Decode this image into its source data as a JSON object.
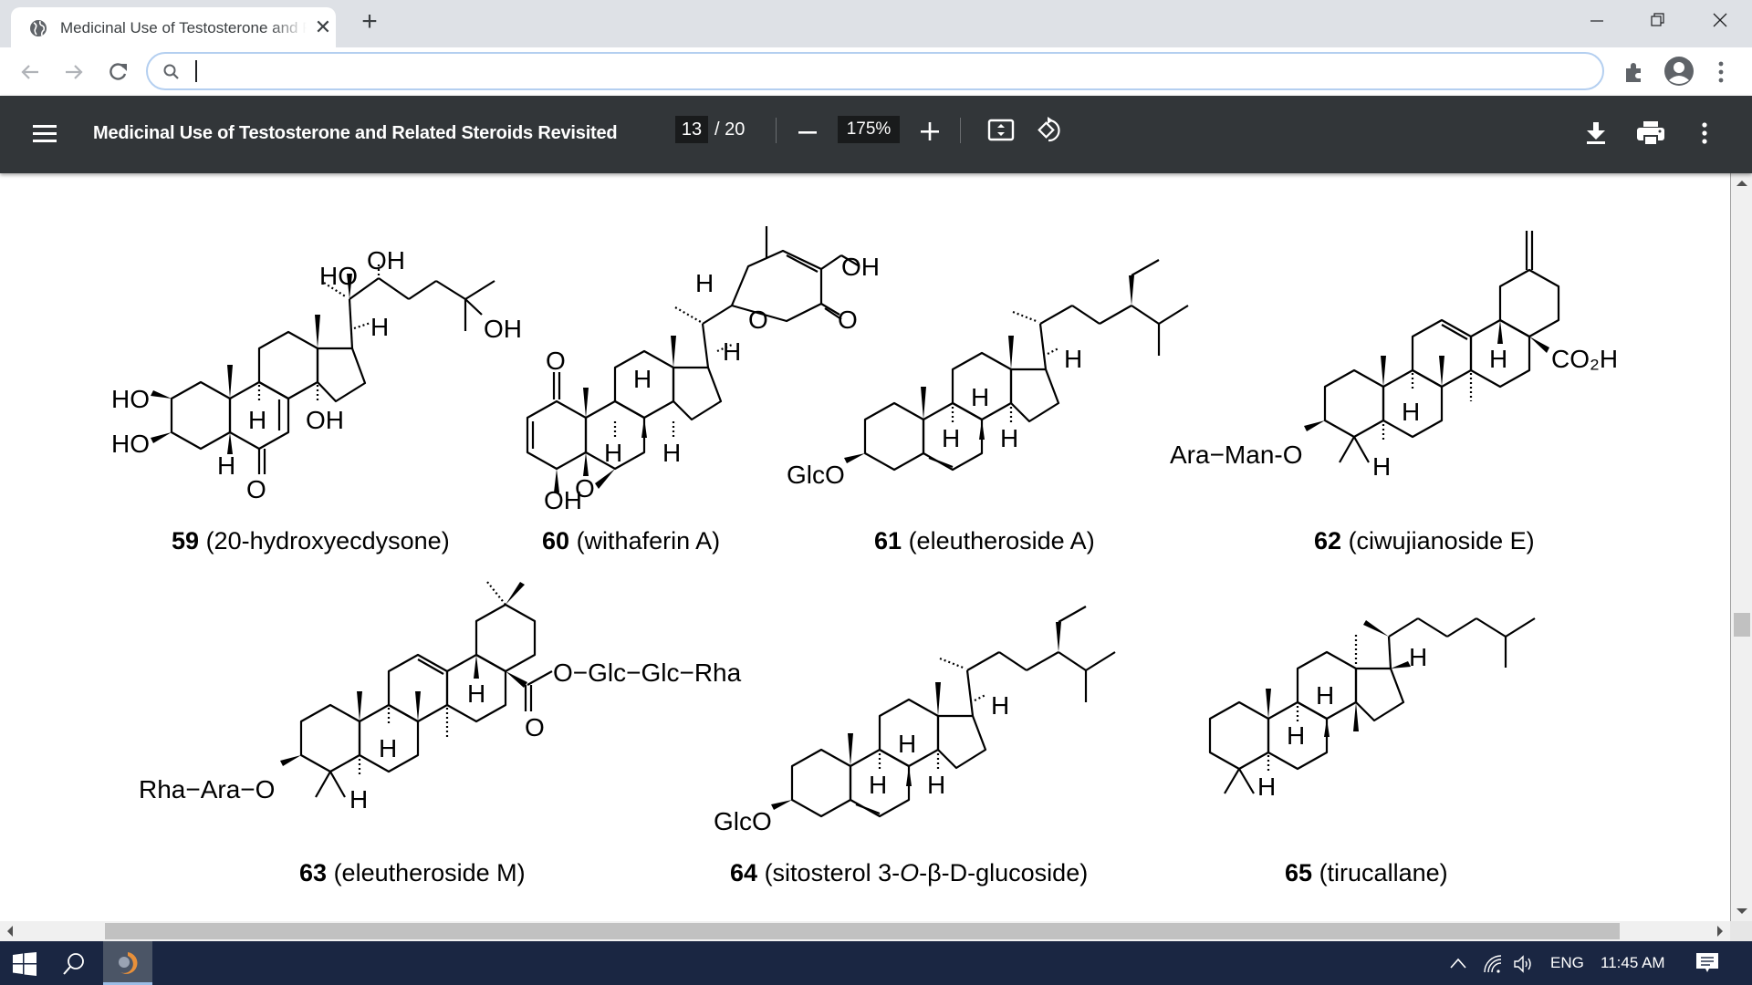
{
  "browser": {
    "tab": {
      "title": "Medicinal Use of Testosterone and Related Steroids Revisited",
      "icon": "globe-icon",
      "close_icon": "close-icon"
    },
    "new_tab_icon": "plus-icon",
    "window_controls": {
      "minimize": "minimize-icon",
      "restore": "restore-icon",
      "close": "close-icon"
    },
    "nav": {
      "back": "back-arrow-icon",
      "forward": "forward-arrow-icon",
      "reload": "reload-icon"
    },
    "omnibox": {
      "value": "",
      "placeholder": "",
      "icon": "search-icon"
    },
    "toolbar_icons": [
      "extensions-puzzle-icon",
      "profile-avatar-icon",
      "more-vert-icon"
    ]
  },
  "pdf_toolbar": {
    "menu_icon": "hamburger-menu-icon",
    "title": "Medicinal Use of Testosterone and Related Steroids Revisited",
    "current_page": "13",
    "page_total": "/ 20",
    "zoom_out_icon": "minus-icon",
    "zoom_level": "175%",
    "zoom_in_icon": "plus-icon",
    "fit_icon": "fit-to-page-icon",
    "rotate_icon": "rotate-counterclockwise-icon",
    "download_icon": "download-icon",
    "print_icon": "print-icon",
    "more_icon": "more-vert-icon"
  },
  "compounds": [
    {
      "number": "59",
      "name": "(20-hydroxyecdysone)",
      "labels": {
        "oh_top": "OH",
        "ho_side": "HO",
        "oh_tail": "OH",
        "h17": "H",
        "ho2": "HO",
        "ho3": "HO",
        "h9": "H",
        "oh14": "OH",
        "h5": "H",
        "o6": "O"
      }
    },
    {
      "number": "60",
      "name": "(withaferin A)",
      "labels": {
        "oh_side": "OH",
        "h_side": "H",
        "o_ring": "O",
        "o_keto": "O",
        "h17": "H",
        "o1": "O",
        "h8": "H",
        "h9": "H",
        "h14": "H",
        "o_epox": "O",
        "oh4": "OH"
      }
    },
    {
      "number": "61",
      "name": "(eleutheroside A)",
      "labels": {
        "h17": "H",
        "h8": "H",
        "h9": "H",
        "h14": "H",
        "glco": "GlcO"
      }
    },
    {
      "number": "62",
      "name": "(ciwujianoside E)",
      "labels": {
        "co2h": "CO₂H",
        "h18": "H",
        "h9": "H",
        "h5": "H",
        "sugar": "Ara−Man-O"
      }
    },
    {
      "number": "63",
      "name": "(eleutheroside M)",
      "labels": {
        "ester": "O−Glc−Glc−Rha",
        "o_carbonyl": "O",
        "h18": "H",
        "h9": "H",
        "h5": "H",
        "sugar": "Rha−Ara−O"
      }
    },
    {
      "number": "64",
      "name_prefix": "(sitosterol 3-",
      "name_italic": "O",
      "name_suffix": "-β-D-glucoside)",
      "labels": {
        "h17": "H",
        "h8": "H",
        "h9": "H",
        "h14": "H",
        "glco": "GlcO"
      }
    },
    {
      "number": "65",
      "name": "(tirucallane)",
      "labels": {
        "h17": "H",
        "h8": "H",
        "h9": "H",
        "h5": "H"
      }
    }
  ],
  "scrollbars": {
    "vertical_position": 0.6,
    "horizontal_visible_fraction": 0.88
  },
  "taskbar": {
    "start_icon": "windows-start-icon",
    "search_icon": "search-icon",
    "pinned_app": "browser-app-icon",
    "tray": {
      "chevron": "show-hidden-icons-chevron-icon",
      "network": "wifi-icon",
      "volume": "volume-icon",
      "language": "ENG",
      "time": "11:45 AM",
      "notifications": "action-center-icon"
    }
  }
}
